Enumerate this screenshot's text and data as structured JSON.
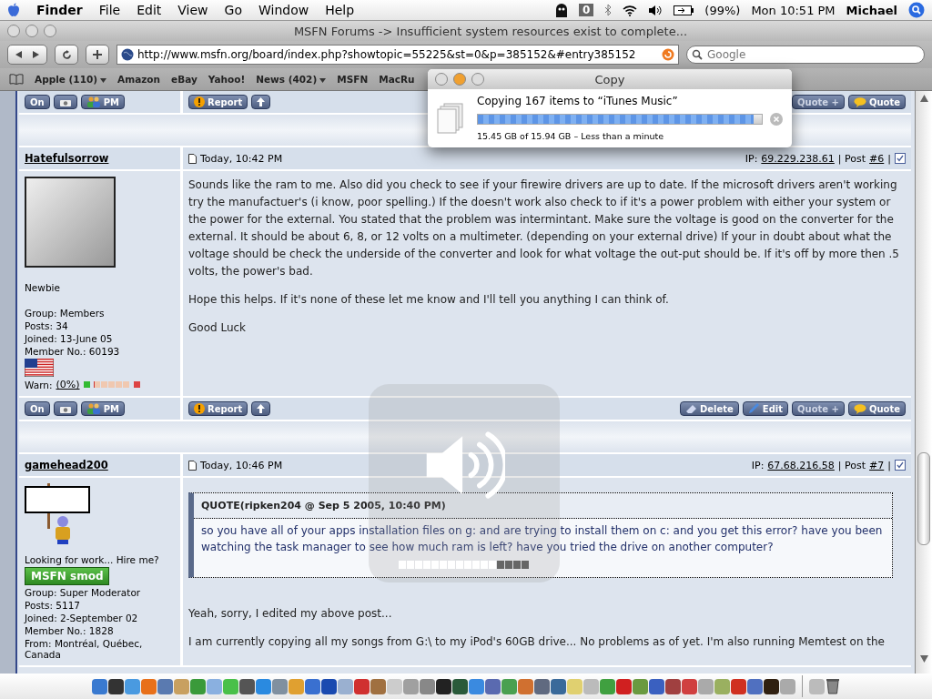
{
  "menu_bar": {
    "app": "Finder",
    "items": [
      "File",
      "Edit",
      "View",
      "Go",
      "Window",
      "Help"
    ],
    "badge": "0",
    "battery": "(99%)",
    "clock": "Mon 10:51 PM",
    "user": "Michael"
  },
  "browser": {
    "title": "MSFN Forums -> Insufficient system resources exist to complete...",
    "url": "http://www.msfn.org/board/index.php?showtopic=55225&st=0&p=385152&#entry385152",
    "search": {
      "placeholder": "Google"
    },
    "bookmarks": [
      {
        "label": "Apple (110)",
        "menu": true
      },
      {
        "label": "Amazon",
        "menu": false
      },
      {
        "label": "eBay",
        "menu": false
      },
      {
        "label": "Yahoo!",
        "menu": false
      },
      {
        "label": "News (402)",
        "menu": true
      },
      {
        "label": "MSFN",
        "menu": false
      },
      {
        "label": "MacRu",
        "menu": false
      }
    ]
  },
  "forum": {
    "top_bar": {
      "left": [
        {
          "kind": "plain",
          "label": "On"
        },
        {
          "kind": "camera"
        },
        {
          "kind": "people",
          "label": "PM"
        }
      ],
      "middle": [
        {
          "kind": "warning",
          "label": "Report"
        },
        {
          "kind": "up"
        }
      ],
      "right": [
        {
          "kind": "muted",
          "label": "Quote +"
        },
        {
          "kind": "speech",
          "label": "Quote"
        }
      ]
    },
    "posts": [
      {
        "author": "Hatefulsorrow",
        "date": "Today, 10:42 PM",
        "ip_label": "IP:",
        "ip": "69.229.238.61",
        "post_label": "| Post",
        "post_number": "#6",
        "end_mark": "|",
        "checked": true,
        "info": [
          {
            "kind": "photo"
          },
          {
            "kind": "text",
            "text": "Newbie"
          },
          {
            "kind": "gap"
          },
          {
            "kind": "text",
            "text": "Group: Members"
          },
          {
            "kind": "text",
            "text": "Posts: 34"
          },
          {
            "kind": "text",
            "text": "Joined: 13-June 05"
          },
          {
            "kind": "text",
            "text": "Member No.: 60193"
          },
          {
            "kind": "flag"
          },
          {
            "kind": "warn",
            "text": "Warn:",
            "value": "(0%)",
            "level": 0
          }
        ],
        "paragraphs": [
          "Sounds like the ram to me. Also did you check to see if your firewire drivers are up to date. If the microsoft drivers aren't working try the manufactuer's (i know, poor spelling.) If the doesn't work also check to if it's a power problem with either your system or the power for the external. You stated that the problem was intermintant. Make sure the voltage is good on the converter for the external. It should be about 6, 8, or 12 volts on a multimeter. (depending on your external drive) If your in doubt about what the voltage should be check the underside of the converter and look for what voltage the out-put should be. If it's off by more then .5 volts, the power's bad.",
          "Hope this helps. If it's none of these let me know and I'll tell you anything I can think of.",
          "Good Luck"
        ],
        "buttons": {
          "left": [
            {
              "kind": "plain",
              "label": "On"
            },
            {
              "kind": "camera"
            },
            {
              "kind": "people",
              "label": "PM"
            }
          ],
          "middle": [
            {
              "kind": "warning",
              "label": "Report"
            },
            {
              "kind": "up"
            }
          ],
          "right": [
            {
              "kind": "eraser",
              "label": "Delete"
            },
            {
              "kind": "pencil",
              "label": "Edit"
            },
            {
              "kind": "muted",
              "label": "Quote +"
            },
            {
              "kind": "speech",
              "label": "Quote"
            }
          ]
        }
      },
      {
        "author": "gamehead200",
        "date": "Today, 10:46 PM",
        "ip_label": "IP:",
        "ip": "67.68.216.58",
        "post_label": "| Post",
        "post_number": "#7",
        "end_mark": "|",
        "checked": true,
        "info": [
          {
            "kind": "sign"
          },
          {
            "kind": "text",
            "text": "Looking for work... Hire me?"
          },
          {
            "kind": "badge",
            "text": "MSFN smod"
          },
          {
            "kind": "text",
            "text": "Group: Super Moderator"
          },
          {
            "kind": "text",
            "text": "Posts: 5117"
          },
          {
            "kind": "text",
            "text": "Joined: 2-September 02"
          },
          {
            "kind": "text",
            "text": "Member No.: 1828"
          },
          {
            "kind": "text",
            "text": "From: Montréal, Québec, Canada"
          }
        ],
        "quote": {
          "header": "QUOTE(ripken204 @ Sep 5 2005, 10:40 PM)",
          "text": "so you have all of your apps installation files on g: and are trying to install them on c: and you get this error? have you been watching the task manager to see how much ram is left? have you tried the drive on another computer?"
        },
        "paragraphs": [
          "Yeah, sorry, I edited my above post...",
          "I am currently copying all my songs from G:\\ to my iPod's 60GB drive... No problems as of yet. I'm also running Memtest on the"
        ]
      }
    ]
  },
  "copy_dialog": {
    "title": "Copy",
    "message": "Copying 167 items to “iTunes Music”",
    "level": 0.97,
    "status": "15.45 GB of 15.94 GB – Less than a minute"
  },
  "volume_hud": {
    "level": 0.75
  }
}
